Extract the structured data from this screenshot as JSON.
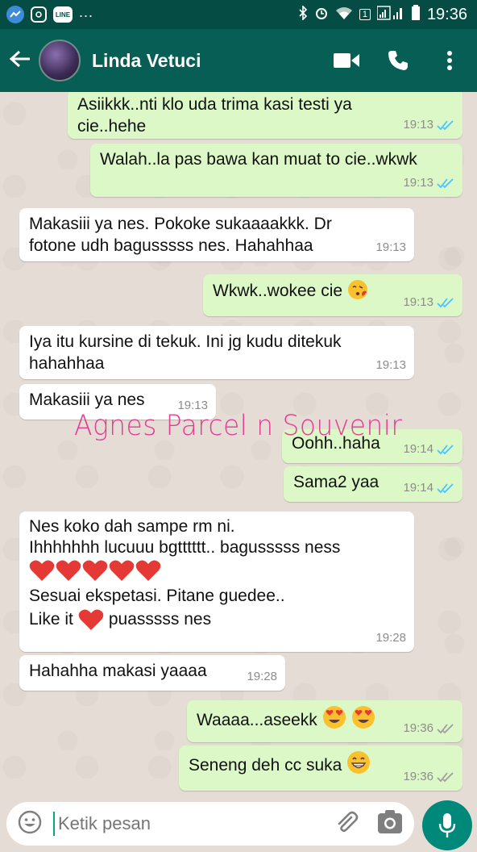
{
  "status_bar": {
    "time": "19:36",
    "sim": "1",
    "dots": "...",
    "line_label": "LINE"
  },
  "header": {
    "contact_name": "Linda Vetuci"
  },
  "messages": [
    {
      "dir": "out",
      "lines": [
        "Asiikkk..nti klo uda trima kasi testi ya",
        "cie..hehe"
      ],
      "time": "19:13",
      "read": true
    },
    {
      "dir": "out",
      "lines": [
        "Walah..la pas bawa kan muat to cie..wkwk"
      ],
      "time": "19:13",
      "read": true
    },
    {
      "dir": "in",
      "lines": [
        "Makasiii ya nes. Pokoke sukaaaakkk. Dr",
        "fotone udh bagusssss nes. Hahahhaa"
      ],
      "time": "19:13"
    },
    {
      "dir": "out",
      "lines": [
        "Wkwk..wokee cie"
      ],
      "emoji": "kiss-face-emoji",
      "time": "19:13",
      "read": true
    },
    {
      "dir": "in",
      "lines": [
        "Iya itu kursine di tekuk. Ini jg kudu ditekuk",
        "hahahhaa"
      ],
      "time": "19:13"
    },
    {
      "dir": "in",
      "lines": [
        "Makasiii ya nes"
      ],
      "time": "19:13"
    },
    {
      "dir": "out",
      "lines": [
        "Oohh..haha"
      ],
      "time": "19:14",
      "read": true
    },
    {
      "dir": "out",
      "lines": [
        "Sama2 yaa"
      ],
      "time": "19:14",
      "read": true
    },
    {
      "dir": "in",
      "lines": [
        "Nes koko dah sampe rm ni.",
        "Ihhhhhhh lucuuu bgtttttt.. bagusssss ness",
        "Sesuai ekspetasi. Pitane guedee..",
        "Like it",
        "puasssss nes"
      ],
      "hearts": 5,
      "time": "19:28"
    },
    {
      "dir": "in",
      "lines": [
        "Hahahha makasi yaaaa"
      ],
      "time": "19:28"
    },
    {
      "dir": "out",
      "lines": [
        "Waaaa...aseekk"
      ],
      "emoji": "heart-eyes-emoji",
      "time": "19:36",
      "read": false
    },
    {
      "dir": "out",
      "lines": [
        "Seneng deh cc suka"
      ],
      "emoji": "grinning-face-emoji",
      "time": "19:36",
      "read": false
    }
  ],
  "watermark": "Agnes Parcel n Souvenir",
  "composer": {
    "placeholder": "Ketik pesan"
  },
  "colors": {
    "header": "#075e54",
    "statusbar": "#054d44",
    "outgoing": "#dcf8c6",
    "incoming": "#ffffff",
    "read_tick": "#4fc3f7",
    "mic": "#00897b"
  }
}
